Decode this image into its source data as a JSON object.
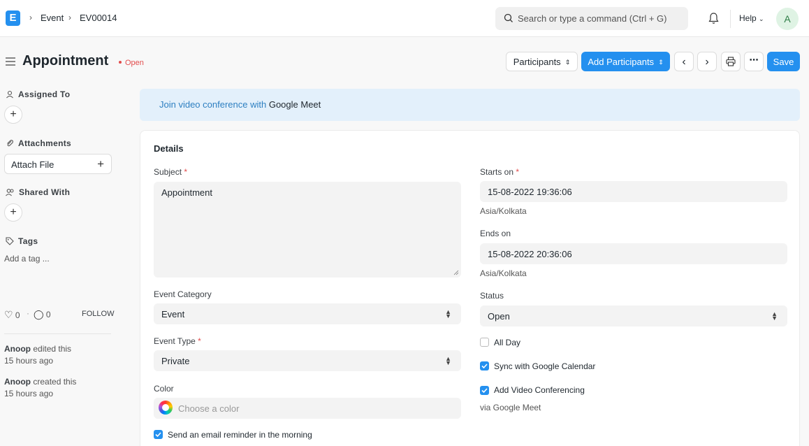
{
  "navbar": {
    "logo": "E",
    "breadcrumbs": [
      "Event",
      "EV00014"
    ],
    "search_placeholder": "Search or type a command (Ctrl + G)",
    "help_label": "Help",
    "avatar_initial": "A"
  },
  "page": {
    "title": "Appointment",
    "status": "Open",
    "buttons": {
      "participants": "Participants",
      "add_participants": "Add Participants",
      "save": "Save"
    }
  },
  "sidebar": {
    "assigned_to": "Assigned To",
    "attachments": "Attachments",
    "attach_file": "Attach File",
    "shared_with": "Shared With",
    "tags": "Tags",
    "add_tag": "Add a tag ...",
    "likes": "0",
    "comments": "0",
    "follow": "FOLLOW",
    "activity": [
      {
        "user": "Anoop",
        "action": "edited this",
        "time": "15 hours ago"
      },
      {
        "user": "Anoop",
        "action": "created this",
        "time": "15 hours ago"
      }
    ]
  },
  "banner": {
    "link_text": "Join video conference with",
    "service": "Google Meet"
  },
  "form": {
    "section": "Details",
    "subject": {
      "label": "Subject",
      "value": "Appointment"
    },
    "event_category": {
      "label": "Event Category",
      "value": "Event"
    },
    "event_type": {
      "label": "Event Type",
      "value": "Private"
    },
    "color": {
      "label": "Color",
      "placeholder": "Choose a color"
    },
    "send_reminder": {
      "label": "Send an email reminder in the morning",
      "checked": true
    },
    "starts_on": {
      "label": "Starts on",
      "value": "15-08-2022 19:36:06",
      "tz": "Asia/Kolkata"
    },
    "ends_on": {
      "label": "Ends on",
      "value": "15-08-2022 20:36:06",
      "tz": "Asia/Kolkata"
    },
    "status": {
      "label": "Status",
      "value": "Open"
    },
    "all_day": {
      "label": "All Day",
      "checked": false
    },
    "sync_google": {
      "label": "Sync with Google Calendar",
      "checked": true
    },
    "add_video": {
      "label": "Add Video Conferencing",
      "checked": true
    },
    "via": "via Google Meet"
  },
  "colors": {
    "primary": "#2490ef",
    "danger": "#e24c4c",
    "banner_bg": "#e3f0fb"
  }
}
